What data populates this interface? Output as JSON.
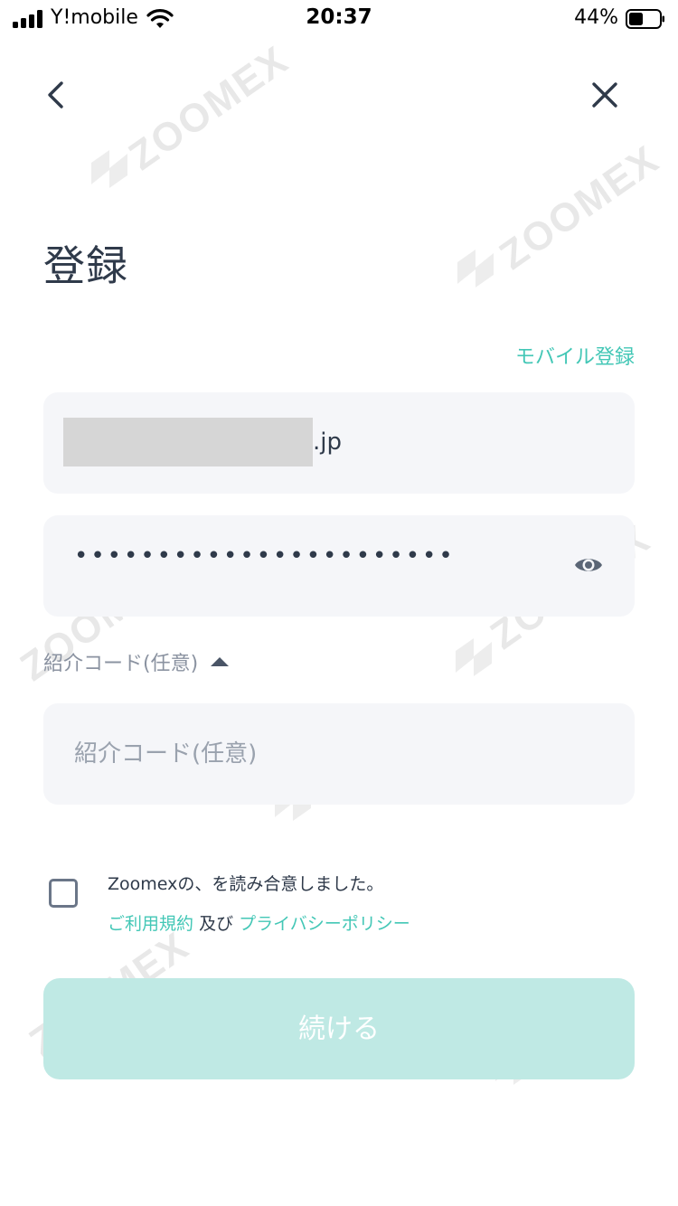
{
  "status_bar": {
    "carrier": "Y!mobile",
    "time": "20:37",
    "battery_percent": "44%"
  },
  "nav": {
    "back_icon": "chevron-left-icon",
    "close_icon": "close-icon"
  },
  "page": {
    "title": "登録",
    "mobile_register_link": "モバイル登録"
  },
  "form": {
    "email_suffix": ".jp",
    "password_masked": "•••••••••••••••••••••••",
    "referral_toggle_label": "紹介コード(任意)",
    "referral_placeholder": "紹介コード(任意)",
    "referral_value": ""
  },
  "agreement": {
    "line1": "Zoomexの、を読み合意しました。",
    "terms_link": "ご利用規約",
    "conjunction": "及び",
    "privacy_link": "プライバシーポリシー",
    "checked": false
  },
  "actions": {
    "continue_label": "続ける"
  },
  "watermark": {
    "text": "ZOOMEX"
  },
  "colors": {
    "accent": "#43c7b6",
    "button_disabled": "#bfe9e4",
    "field_bg": "#f5f6f9",
    "text_primary": "#2f3a4a",
    "text_muted": "#9aa2ae"
  }
}
